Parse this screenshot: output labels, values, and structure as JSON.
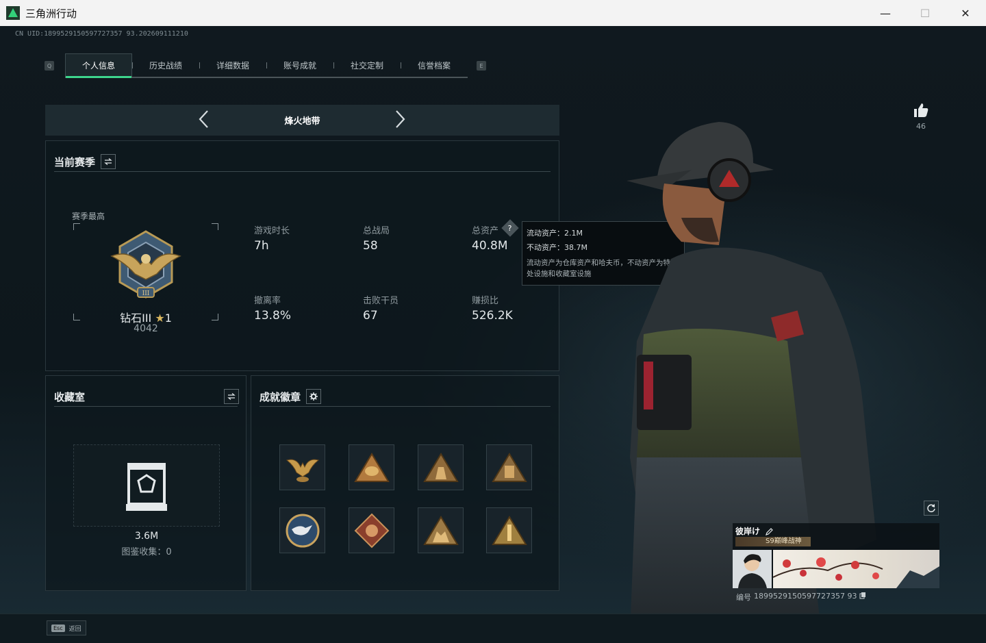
{
  "window": {
    "title": "三角洲行动",
    "minimize": "—",
    "maximize": "☐",
    "close": "✕"
  },
  "uid_line": "CN UID:1899529150597727357 93.202609111210",
  "ghost_heading": "",
  "tabs": [
    {
      "label": "个人信息",
      "active": true
    },
    {
      "label": "历史战绩"
    },
    {
      "label": "详细数据"
    },
    {
      "label": "账号成就"
    },
    {
      "label": "社交定制"
    },
    {
      "label": "信誉档案"
    }
  ],
  "tab_keys": {
    "left": "Q",
    "right": "E"
  },
  "mode": {
    "title": "烽火地带",
    "prev": "‹",
    "next": "›"
  },
  "season": {
    "title": "当前赛季",
    "peak_label": "赛季最高",
    "rank_name": "钻石III",
    "rank_stars": "1",
    "rank_points": "4042",
    "stats": [
      {
        "label": "游戏时长",
        "value": "7h"
      },
      {
        "label": "总战局",
        "value": "58"
      },
      {
        "label": "总资产",
        "value": "40.8M"
      },
      {
        "label": "撤离率",
        "value": "13.8%"
      },
      {
        "label": "击败干员",
        "value": "67"
      },
      {
        "label": "赚损比",
        "value": "526.2K"
      }
    ]
  },
  "tooltip": {
    "line1_label": "流动资产：",
    "line1_value": "2.1M",
    "line2_label": "不动资产：",
    "line2_value": "38.7M",
    "desc": "流动资产为仓库资产和哈夫币，不动资产为特勤处设施和收藏室设施"
  },
  "collection": {
    "title": "收藏室",
    "value": "3.6M",
    "caption": "图鉴收集：0"
  },
  "badges": {
    "title": "成就徽章"
  },
  "likes": {
    "count": "46"
  },
  "player_card": {
    "name": "彼岸け",
    "title_tag": "S9巅峰战神",
    "id_label": "编号",
    "id": "1899529150597727357 93"
  },
  "footer": {
    "key": "Esc",
    "label": "返回"
  },
  "colors": {
    "accent": "#3ed68d",
    "panel_bg": "#0e181d"
  }
}
